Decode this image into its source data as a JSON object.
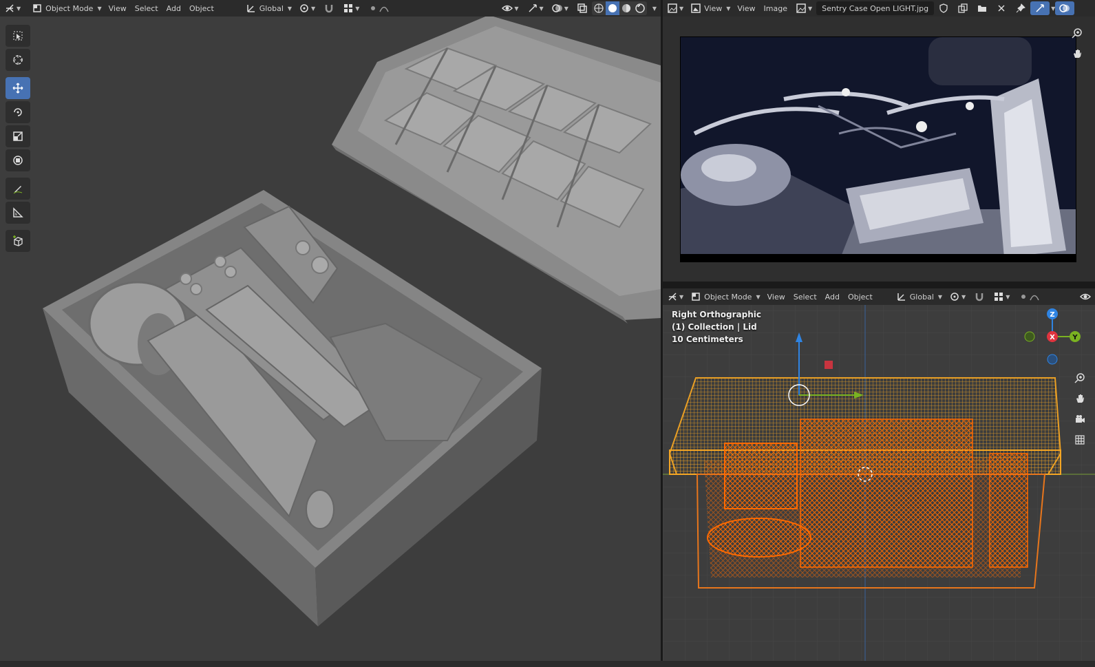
{
  "left_header": {
    "mode": "Object Mode",
    "menus": [
      "View",
      "Select",
      "Add",
      "Object"
    ],
    "transform": "Global"
  },
  "image_header": {
    "menus": [
      "View",
      "View",
      "Image"
    ],
    "image_name": "Sentry Case Open LIGHT.jpg"
  },
  "right_header": {
    "mode": "Object Mode",
    "menus": [
      "View",
      "Select",
      "Add",
      "Object"
    ],
    "transform": "Global"
  },
  "right_overlay": {
    "view_name": "Right Orthographic",
    "collection": "(1) Collection | Lid",
    "scale": "10 Centimeters"
  },
  "gizmo": {
    "z": "Z",
    "x": "X",
    "y": "Y"
  },
  "tools": [
    "select-box",
    "cursor",
    "move",
    "rotate",
    "scale",
    "transform",
    "annotate",
    "measure",
    "add-cube"
  ],
  "colors": {
    "accent": "#4772b3",
    "wire_orange": "#e8761c",
    "wire_light": "#f5a623",
    "axis_x": "#e0343f",
    "axis_y": "#7ab221",
    "axis_z": "#2f84e3"
  }
}
